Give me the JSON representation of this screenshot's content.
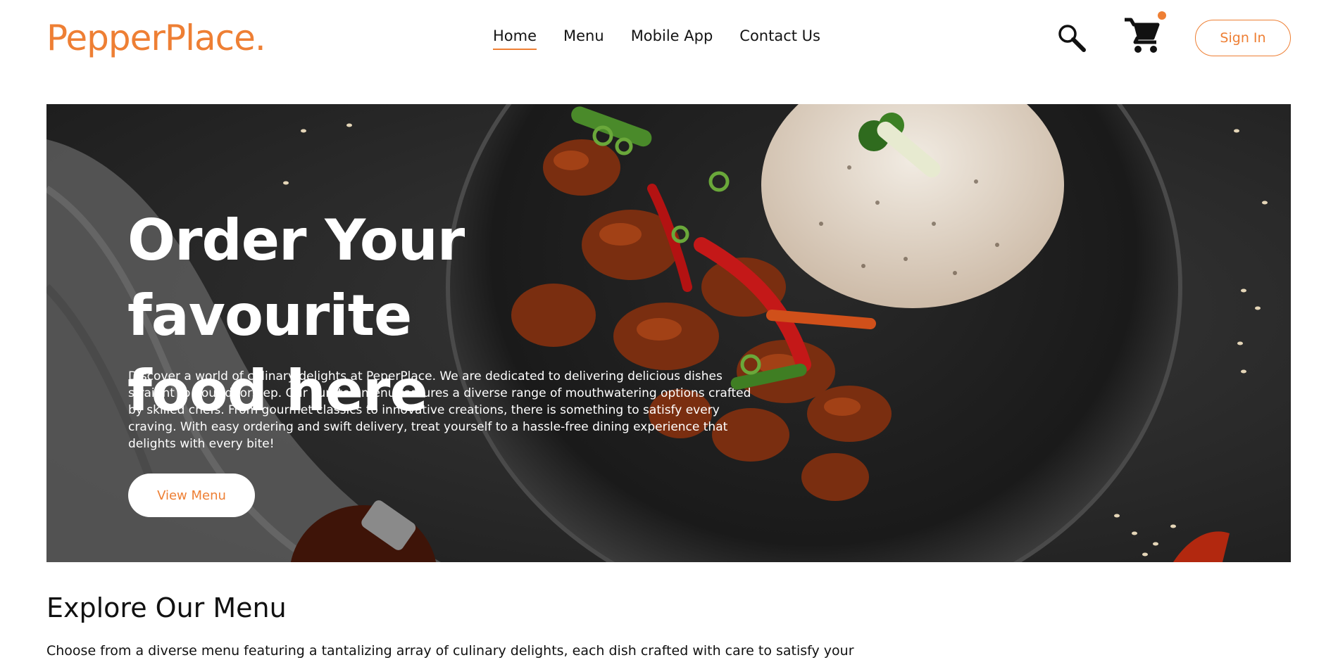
{
  "header": {
    "logo": "PepperPlace.",
    "nav": [
      {
        "label": "Home",
        "active": true
      },
      {
        "label": "Menu",
        "active": false
      },
      {
        "label": "Mobile App",
        "active": false
      },
      {
        "label": "Contact Us",
        "active": false
      }
    ],
    "search_icon": "search-icon",
    "cart_icon": "cart-icon",
    "cart_badge": "notification-dot",
    "signin_label": "Sign In"
  },
  "hero": {
    "title_line1": "Order Your favourite",
    "title_line2": "food here",
    "description": "Discover a world of culinary delights at PeperPlace. We are dedicated to delivering delicious dishes straight to your doorstep. Our curated menu features a diverse range of mouthwatering options crafted by skilled chefs. From gourmet classics to innovative creations, there is something to satisfy every craving. With easy ordering and swift delivery, treat yourself to a hassle-free dining experience that delights with every bite!",
    "button_label": "View Menu"
  },
  "explore": {
    "title": "Explore Our Menu",
    "text": "Choose from a diverse menu featuring a tantalizing array of culinary delights, each dish crafted with care to satisfy your"
  },
  "colors": {
    "accent": "#ee7f34",
    "hero_bg": "#262626",
    "text": "#111111"
  }
}
